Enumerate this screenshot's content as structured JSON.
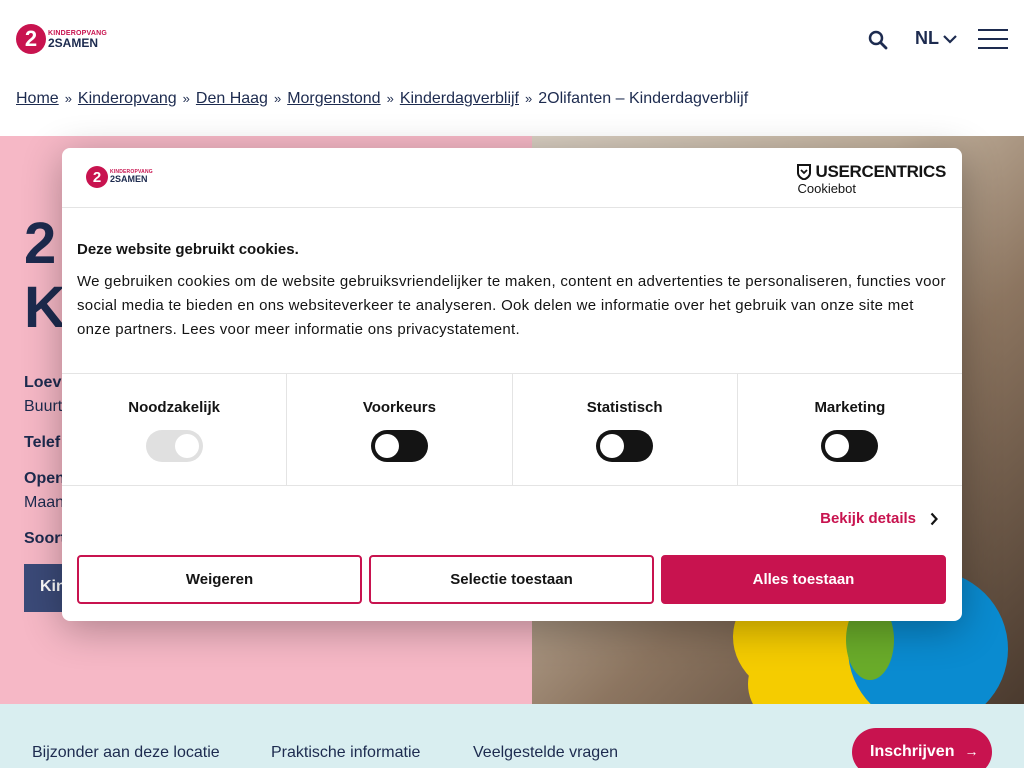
{
  "header": {
    "logo_mark": "2",
    "logo_line1": "KINDEROPVANG",
    "logo_line2": "2SAMEN",
    "language": "NL"
  },
  "breadcrumb": [
    "Home",
    "Kinderopvang",
    "Den Haag",
    "Morgenstond",
    "Kinderdagverblijf",
    "2Olifanten – Kinderdagverblijf"
  ],
  "breadcrumb_separator": "»",
  "hero": {
    "title_line1": "2",
    "title_line2": "K",
    "info": [
      "Loev",
      "Buurt",
      "Telef",
      "Open",
      "Maan",
      "Soort"
    ],
    "button_label": "Kin"
  },
  "subnav": {
    "items": [
      "Bijzonder aan deze locatie",
      "Praktische informatie",
      "Veelgestelde vragen"
    ],
    "cta": "Inschrijven",
    "cta_arrow": "→"
  },
  "cookie_dialog": {
    "provider_name": "USERCENTRICS",
    "provider_sub": "Cookiebot",
    "heading": "Deze website gebruikt cookies.",
    "body": "We gebruiken cookies om de website gebruiksvriendelijker te maken, content en advertenties te personaliseren, functies voor social media te bieden en ons websiteverkeer te analyseren. Ook delen we informatie over het gebruik van onze site met onze partners. Lees voor meer informatie ons privacystatement.",
    "categories": [
      "Noodzakelijk",
      "Voorkeurs",
      "Statistisch",
      "Marketing"
    ],
    "details_label": "Bekijk details",
    "reject_label": "Weigeren",
    "selection_label": "Selectie toestaan",
    "accept_label": "Alles toestaan"
  },
  "colors": {
    "brand": "#c8134f",
    "navy": "#1d2b4f",
    "hero_pink": "#f6b8c6",
    "subnav_bg": "#d9eef0"
  }
}
